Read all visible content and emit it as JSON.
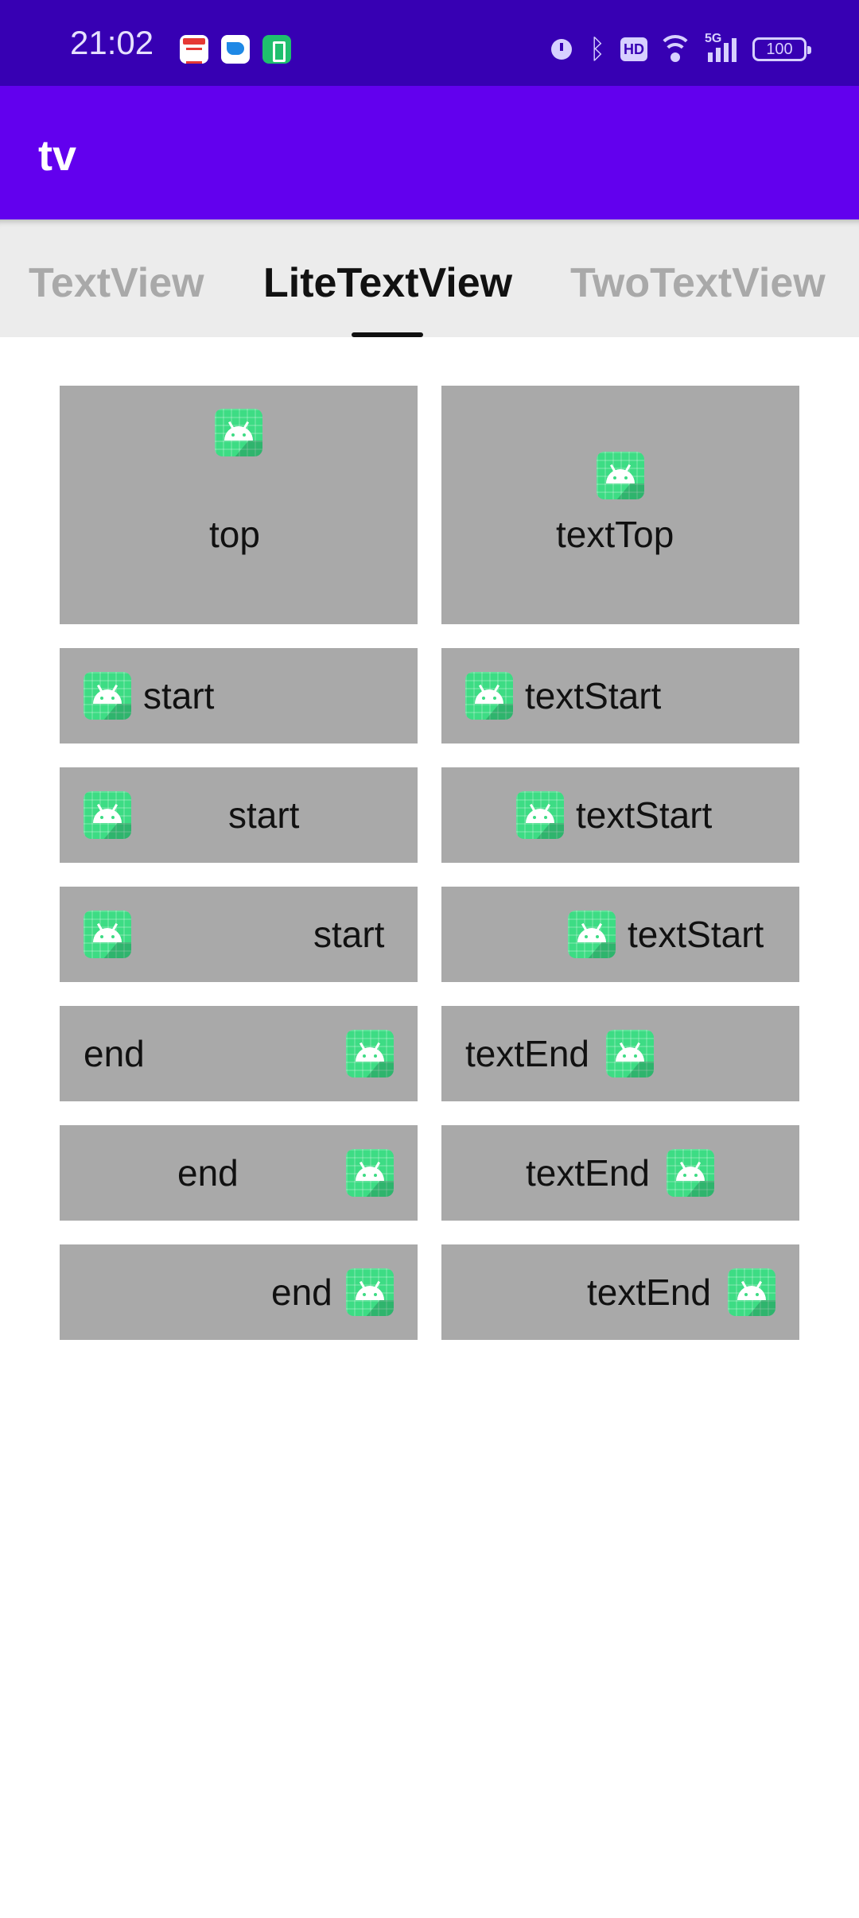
{
  "status_bar": {
    "time": "21:02",
    "notification_icons": [
      "calendar-app-icon",
      "messenger-app-icon",
      "battery-saver-app-icon"
    ],
    "system_icons": [
      "alarm-icon",
      "bluetooth-icon",
      "hd-icon",
      "wifi-icon",
      "signal-icon",
      "battery-icon"
    ],
    "hd_label": "HD",
    "network_label": "5G",
    "battery_level": "100"
  },
  "app_bar": {
    "title": "tv"
  },
  "tabs": [
    {
      "label": "TextView",
      "selected": false
    },
    {
      "label": "LiteTextView",
      "selected": true
    },
    {
      "label": "TwoTextView",
      "selected": false
    }
  ],
  "demo_icon": "android-robot-icon",
  "cells": {
    "top": "top",
    "text_top": "textTop",
    "start_1": "start",
    "text_start_1": "textStart",
    "start_2": "start",
    "text_start_2": "textStart",
    "start_3": "start",
    "text_start_3": "textStart",
    "end_1": "end",
    "text_end_1": "textEnd",
    "end_2": "end",
    "text_end_2": "textEnd",
    "end_3": "end",
    "text_end_3": "textEnd"
  },
  "colors": {
    "status_bar": "#3700b3",
    "app_bar": "#6200ee",
    "tab_bar": "#ececec",
    "cell_background": "#a9a9a9",
    "android_green": "#3ddc84"
  }
}
